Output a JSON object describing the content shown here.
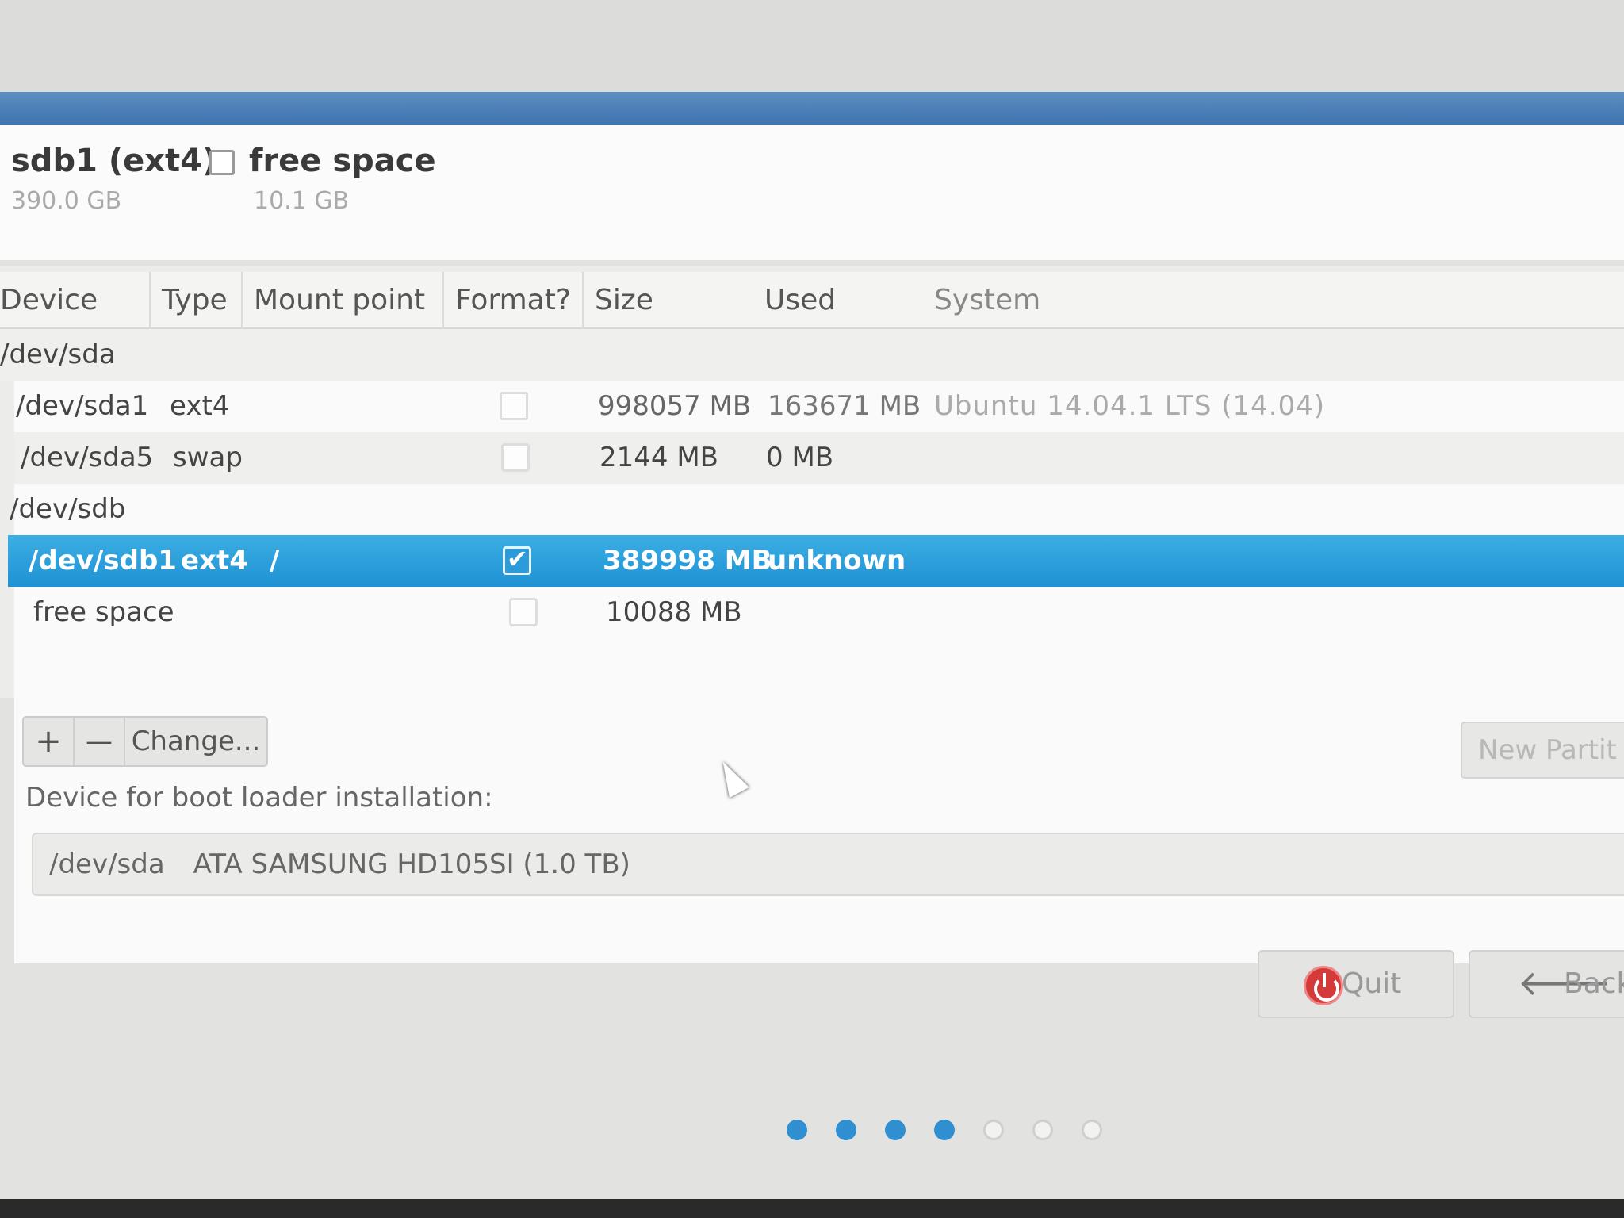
{
  "legend": [
    {
      "name": "sdb1 (ext4)",
      "size": "390.0 GB",
      "has_checkbox": false
    },
    {
      "name": "free space",
      "size": "10.1 GB",
      "has_checkbox": true
    }
  ],
  "table": {
    "columns": [
      "Device",
      "Type",
      "Mount point",
      "Format?",
      "Size",
      "Used",
      "System"
    ],
    "groups": [
      {
        "device": "/dev/sda",
        "rows": [
          {
            "device": "/dev/sda1",
            "type": "ext4",
            "mount": "",
            "format": false,
            "size": "998057 MB",
            "used": "163671 MB",
            "system": "Ubuntu 14.04.1 LTS (14.04)"
          },
          {
            "device": "/dev/sda5",
            "type": "swap",
            "mount": "",
            "format": false,
            "size": "2144 MB",
            "used": "0 MB",
            "system": ""
          }
        ]
      },
      {
        "device": "/dev/sdb",
        "rows": [
          {
            "device": "/dev/sdb1",
            "type": "ext4",
            "mount": "/",
            "format": true,
            "size": "389998 MB",
            "used": "unknown",
            "system": "",
            "selected": true
          },
          {
            "device": "free space",
            "type": "",
            "mount": "",
            "format": false,
            "size": "10088 MB",
            "used": "",
            "system": ""
          }
        ]
      }
    ]
  },
  "toolbar": {
    "add_label": "+",
    "remove_label": "—",
    "change_label": "Change..."
  },
  "new_partition_label": "New Partit",
  "boot_loader": {
    "label": "Device for boot loader installation:",
    "device": "/dev/sda",
    "model": "ATA SAMSUNG HD105SI (1.0 TB)"
  },
  "buttons": {
    "quit_label": "Quit",
    "back_label": "Back"
  },
  "progress": {
    "total_steps": 7,
    "completed_steps": 4
  },
  "colors": {
    "accent": "#2b9cd9",
    "header_bar": "#4a7fb8",
    "quit_icon": "#d43a3a"
  }
}
